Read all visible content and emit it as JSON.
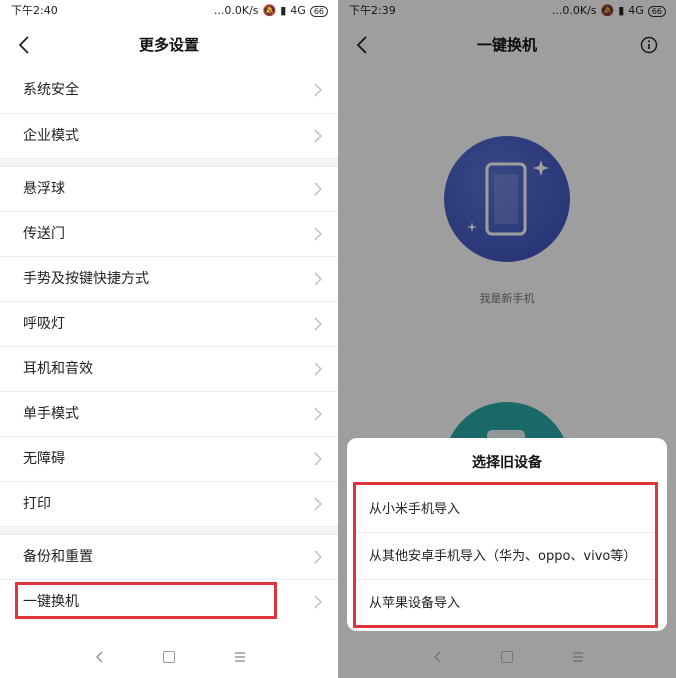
{
  "left": {
    "status": {
      "time": "下午2:40",
      "speed": "...0.0K/s",
      "network": "4G",
      "battery": "66"
    },
    "header": {
      "title": "更多设置"
    },
    "groups": [
      [
        "系统安全",
        "企业模式"
      ],
      [
        "悬浮球",
        "传送门",
        "手势及按键快捷方式",
        "呼吸灯",
        "耳机和音效",
        "单手模式",
        "无障碍",
        "打印"
      ],
      [
        "备份和重置",
        "一键换机"
      ]
    ]
  },
  "right": {
    "status": {
      "time": "下午2:39",
      "speed": "...0.0K/s",
      "network": "4G",
      "battery": "66"
    },
    "header": {
      "title": "一键换机"
    },
    "new_phone_label": "我是新手机",
    "sheet": {
      "title": "选择旧设备",
      "options": [
        "从小米手机导入",
        "从其他安卓手机导入（华为、oppo、vivo等）",
        "从苹果设备导入"
      ]
    }
  },
  "colors": {
    "highlight": "#e0343c",
    "new_circle": "#4a60c8",
    "old_circle": "#2ba8a8"
  }
}
